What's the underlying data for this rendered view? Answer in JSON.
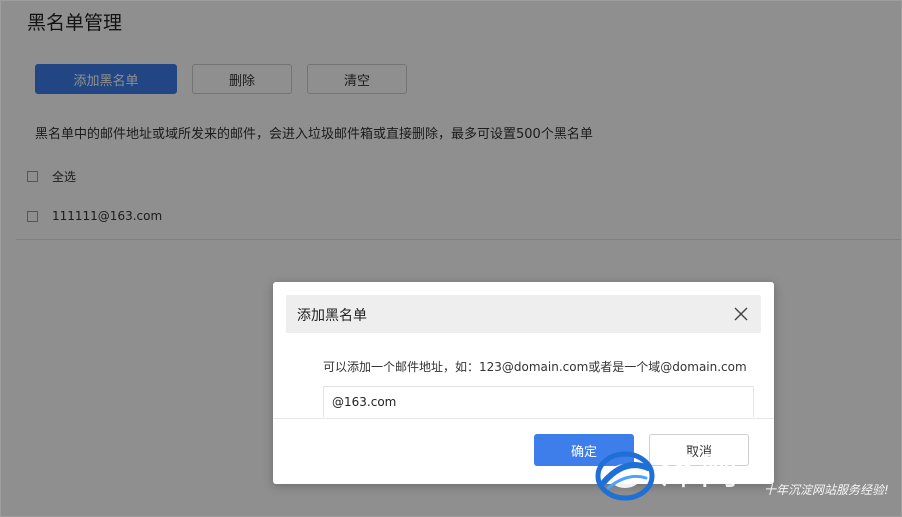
{
  "page": {
    "title": "黑名单管理",
    "toolbar": {
      "add_label": "添加黑名单",
      "delete_label": "删除",
      "clear_label": "清空"
    },
    "description": "黑名单中的邮件地址或域所发来的邮件，会进入垃圾邮件箱或直接删除，最多可设置500个黑名单",
    "select_all_label": "全选",
    "items": [
      {
        "address": "111111@163.com"
      }
    ]
  },
  "modal": {
    "title": "添加黑名单",
    "close_icon": "close-icon",
    "hint": "可以添加一个邮件地址，如：123@domain.com或者是一个域@domain.com",
    "input_value": "@163.com",
    "confirm_label": "确定",
    "cancel_label": "取消"
  },
  "watermark": {
    "brand": "泽网",
    "slogan": "十年沉淀网站服务经验!"
  },
  "colors": {
    "primary": "#3d7eea",
    "overlay": "rgba(0,0,0,0.44)"
  }
}
